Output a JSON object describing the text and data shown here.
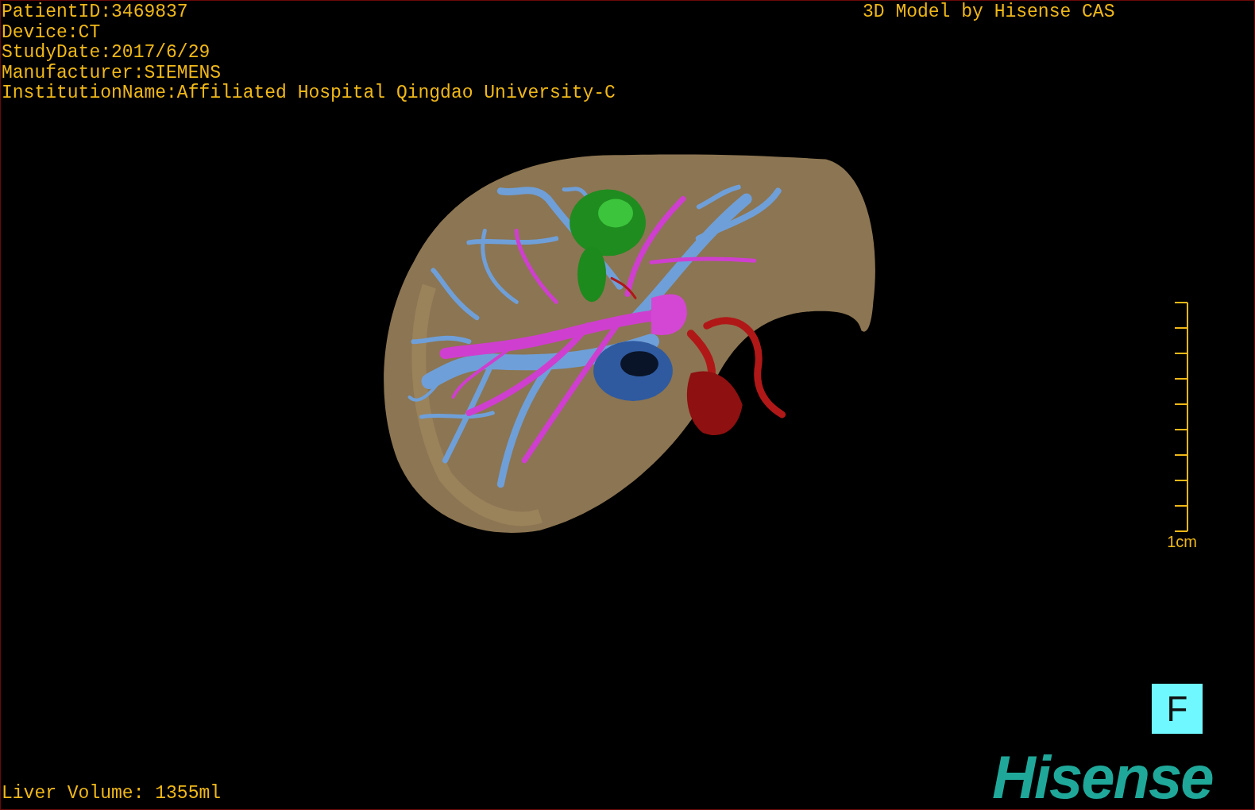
{
  "study_info": [
    "PatientID:3469837",
    "Device:CT",
    "StudyDate:2017/6/29",
    "Manufacturer:SIEMENS",
    "InstitutionName:Affiliated Hospital Qingdao University-C"
  ],
  "credit": "3D Model by Hisense CAS",
  "scale_bar": {
    "label": "1cm"
  },
  "orientation_button": "F",
  "liver_volume": "Liver Volume: 1355ml",
  "logo": "Hisense"
}
